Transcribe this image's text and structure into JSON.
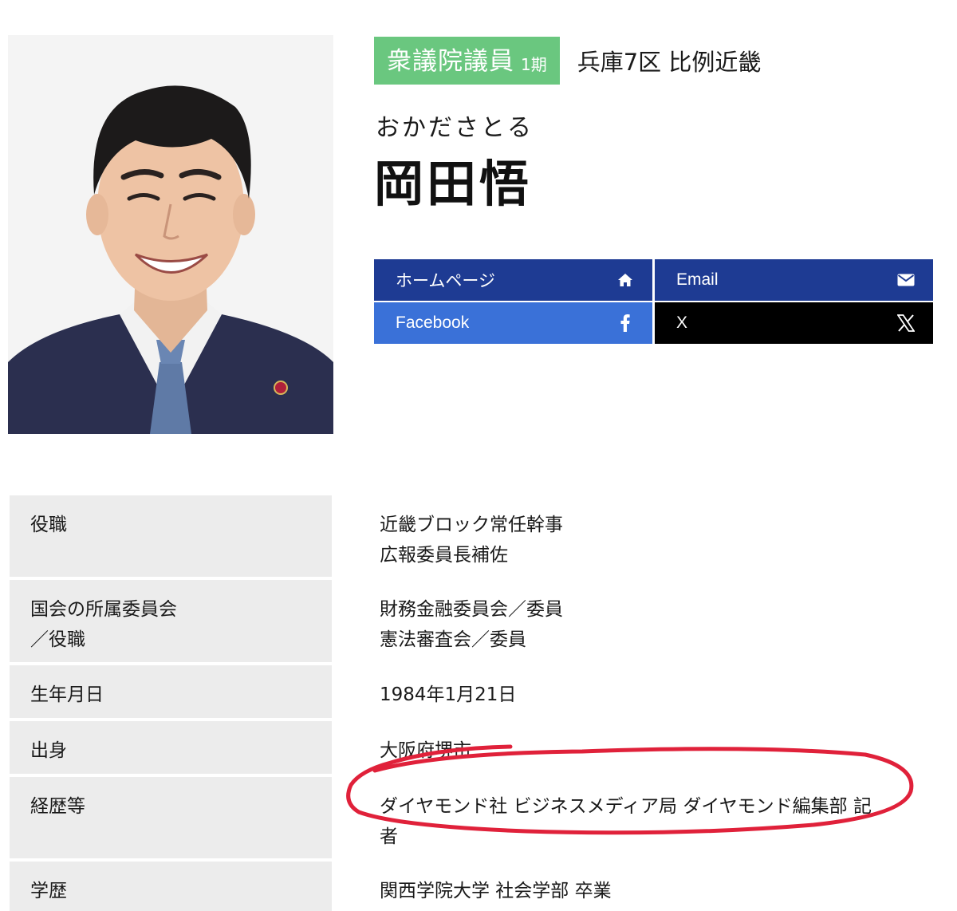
{
  "profile": {
    "chamber": "衆議院議員",
    "term": "1期",
    "district": "兵庫7区 比例近畿",
    "name_kana": "おかださとる",
    "name_kanji": "岡田悟",
    "photo_icon": "portrait-photo"
  },
  "links": {
    "homepage": {
      "label": "ホームページ",
      "icon": "home-icon"
    },
    "email": {
      "label": "Email",
      "icon": "envelope-icon"
    },
    "facebook": {
      "label": "Facebook",
      "icon": "facebook-icon"
    },
    "x": {
      "label": "X",
      "icon": "x-logo-icon"
    }
  },
  "info_rows": [
    {
      "label": "役職",
      "values": [
        "近畿ブロック常任幹事",
        "広報委員長補佐"
      ]
    },
    {
      "label_lines": [
        "国会の所属委員会",
        "／役職"
      ],
      "values": [
        "財務金融委員会／委員",
        "憲法審査会／委員"
      ]
    },
    {
      "label": "生年月日",
      "values": [
        "1984年1月21日"
      ]
    },
    {
      "label": "出身",
      "values": [
        "大阪府堺市"
      ]
    },
    {
      "label": "経歴等",
      "values": [
        "ダイヤモンド社 ビジネスメディア局 ダイヤモンド編集部 記",
        "者"
      ]
    },
    {
      "label": "学歴",
      "values": [
        "関西学院大学 社会学部 卒業"
      ]
    }
  ],
  "colors": {
    "badge_green": "#6ac77f",
    "navy": "#1e3b93",
    "facebook_blue": "#3a71d8",
    "x_black": "#000000",
    "annotation_red": "#e0213a",
    "label_bg": "#ececec"
  }
}
